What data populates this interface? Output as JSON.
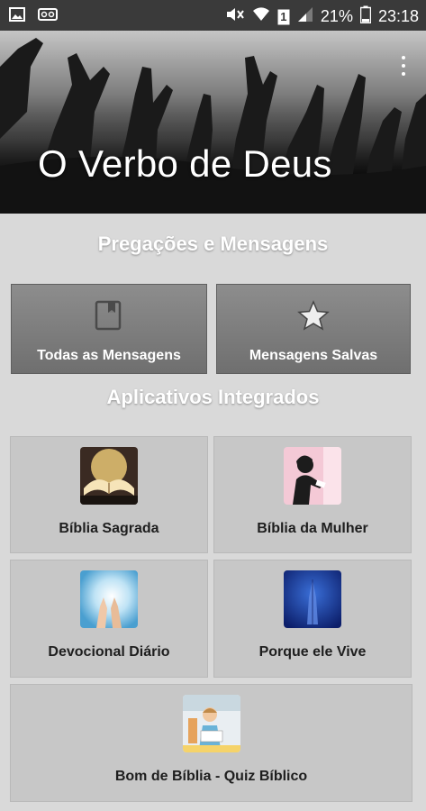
{
  "status_bar": {
    "battery_percent": "21%",
    "sim_slot": "1",
    "time": "23:18",
    "icons": [
      "image-notification-icon",
      "voicemail-icon",
      "mute-icon",
      "wifi-icon",
      "sim-icon",
      "signal-icon",
      "battery-icon"
    ]
  },
  "header": {
    "title": "O Verbo de Deus",
    "menu_icon": "overflow-menu-icon"
  },
  "sections": {
    "messages_heading": "Pregações e Mensagens",
    "apps_heading": "Aplicativos Integrados"
  },
  "message_buttons": [
    {
      "label": "Todas as Mensagens",
      "icon": "book-icon"
    },
    {
      "label": "Mensagens Salvas",
      "icon": "star-icon"
    }
  ],
  "apps": [
    {
      "label": "Bíblia Sagrada",
      "icon": "open-bible-thumbnail"
    },
    {
      "label": "Bíblia da Mulher",
      "icon": "woman-reading-thumbnail"
    },
    {
      "label": "Devocional Diário",
      "icon": "praying-hands-light-thumbnail"
    },
    {
      "label": "Porque ele Vive",
      "icon": "praying-hands-blue-thumbnail"
    },
    {
      "label": "Bom de Bíblia - Quiz Bíblico",
      "icon": "child-reading-thumbnail"
    }
  ],
  "colors": {
    "background": "#d9d9d9",
    "status_bar": "#3a3a3a",
    "dark_button": "#7a7a7a",
    "tile": "#c7c7c7"
  }
}
